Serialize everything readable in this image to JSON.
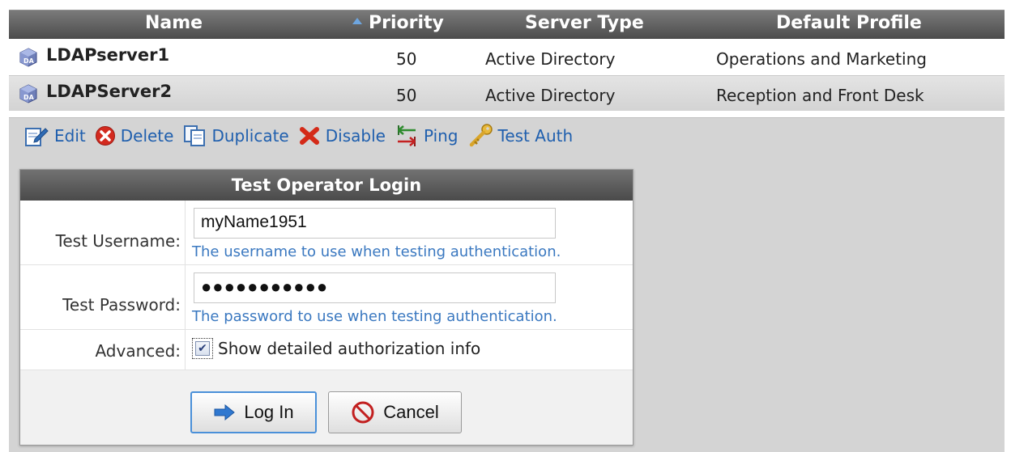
{
  "table": {
    "headers": {
      "name": "Name",
      "priority": "Priority",
      "server_type": "Server Type",
      "default_profile": "Default Profile"
    },
    "sort_indicator": "sort-ascending-icon",
    "rows": [
      {
        "name": "LDAPserver1",
        "priority": "50",
        "server_type": "Active Directory",
        "default_profile": "Operations and Marketing",
        "icon": "ldap-server-icon"
      },
      {
        "name": "LDAPServer2",
        "priority": "50",
        "server_type": "Active Directory",
        "default_profile": "Reception and Front Desk",
        "icon": "ldap-server-icon"
      }
    ]
  },
  "toolbar": {
    "edit": "Edit",
    "delete": "Delete",
    "duplicate": "Duplicate",
    "disable": "Disable",
    "ping": "Ping",
    "test_auth": "Test Auth"
  },
  "dialog": {
    "title": "Test Operator Login",
    "username": {
      "label": "Test Username:",
      "value": "myName1951",
      "hint": "The username to use when testing authentication."
    },
    "password": {
      "label": "Test Password:",
      "value": "●●●●●●●●●●●",
      "hint": "The password to use when testing authentication."
    },
    "advanced": {
      "label": "Advanced:",
      "checkbox_label": "Show detailed authorization info",
      "checked": true
    },
    "buttons": {
      "login": "Log In",
      "cancel": "Cancel"
    }
  },
  "colors": {
    "header_bg": "#5e5e5e",
    "link_blue": "#1f5fae",
    "hint_blue": "#3a78c0",
    "login_border": "#4a90d9"
  }
}
